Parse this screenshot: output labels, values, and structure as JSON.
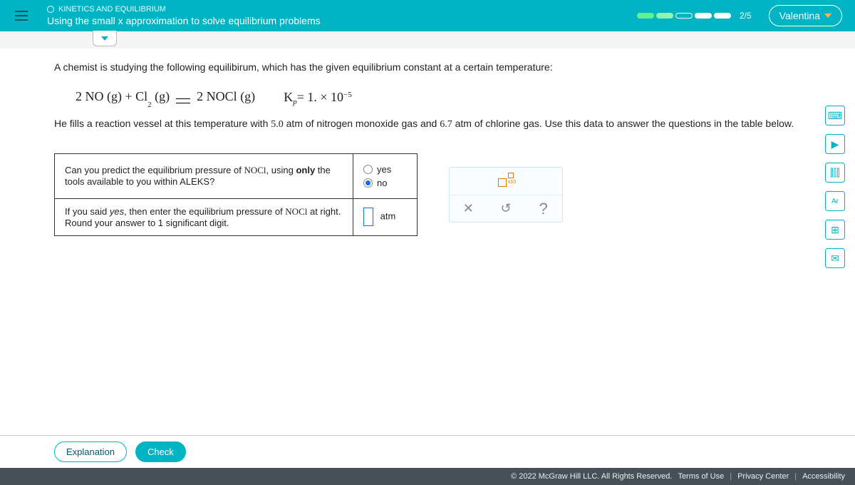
{
  "header": {
    "module": "KINETICS AND EQUILIBRIUM",
    "title": "Using the small x approximation to solve equilibrium problems",
    "progress_count": "2/5",
    "user": "Valentina"
  },
  "problem": {
    "intro": "A chemist is studying the following equilibirum, which has the given equilibrium constant at a certain temperature:",
    "reaction_lhs_1": "2 NO",
    "reaction_lhs_1_phase": "(g)",
    "plus": " + ",
    "reaction_lhs_2": "Cl",
    "reaction_lhs_2_sub": "2",
    "reaction_lhs_2_phase": "(g)",
    "reaction_rhs": "2 NOCl",
    "reaction_rhs_phase": "(g)",
    "kp_label": "K",
    "kp_sub": "p",
    "kp_eq": " = 1. × 10",
    "kp_exp": "−5",
    "setup_a": "He fills a reaction vessel at this temperature with ",
    "setup_no_val": "5.0",
    "setup_b": " atm of nitrogen monoxide gas and ",
    "setup_cl_val": "6.7",
    "setup_c": " atm of chlorine gas. Use this data to answer the questions in the table below."
  },
  "table": {
    "q1_a": "Can you predict the equilibrium pressure of ",
    "q1_species": "NOCl",
    "q1_b": ", using ",
    "q1_only": "only",
    "q1_c": " the tools available to you within ALEKS?",
    "opt_yes": "yes",
    "opt_no": "no",
    "selected": "no",
    "q2_a": "If you said ",
    "q2_yes": "yes",
    "q2_b": ", then enter the equilibrium pressure of ",
    "q2_species": "NOCl",
    "q2_c": " at right. Round your answer to 1 significant digit.",
    "unit": "atm"
  },
  "toolbox": {
    "sci_label": "x10",
    "close": "✕",
    "undo": "↺",
    "help": "?"
  },
  "side": {
    "calc": "⌨",
    "play": "▶",
    "bars": "⫿⫿⫿",
    "periodic": "Ar",
    "data": "⊞",
    "mail": "✉"
  },
  "buttons": {
    "explanation": "Explanation",
    "check": "Check"
  },
  "footer": {
    "copyright": "© 2022 McGraw Hill LLC. All Rights Reserved.",
    "terms": "Terms of Use",
    "privacy": "Privacy Center",
    "accessibility": "Accessibility"
  }
}
